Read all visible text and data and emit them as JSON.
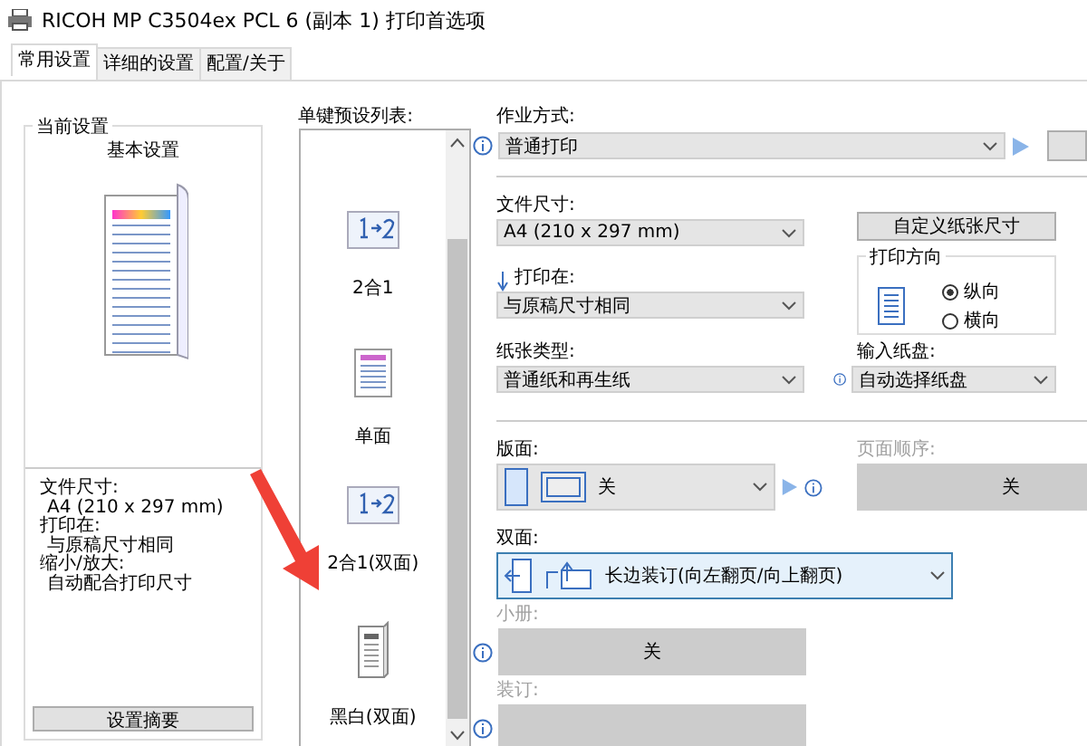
{
  "window": {
    "title": "RICOH MP C3504ex PCL 6 (副本 1) 打印首选项"
  },
  "tabs": [
    {
      "label": "常用设置",
      "selected": true
    },
    {
      "label": "详细的设置",
      "selected": false
    },
    {
      "label": "配置/关于",
      "selected": false
    }
  ],
  "current_settings": {
    "title": "当前设置",
    "preset_name": "基本设置",
    "summary": [
      {
        "label": "文件尺寸:",
        "value": "A4 (210 x 297 mm)"
      },
      {
        "label": "打印在:",
        "value": "与原稿尺寸相同"
      },
      {
        "label": "缩小/放大:",
        "value": "自动配合打印尺寸"
      }
    ],
    "button": "设置摘要"
  },
  "preset_list": {
    "label": "单键预设列表:",
    "items": [
      {
        "label": "2合1",
        "kind": "combine"
      },
      {
        "label": "单面",
        "kind": "page"
      },
      {
        "label": "2合1(双面)",
        "kind": "combine"
      },
      {
        "label": "黑白(双面)",
        "kind": "mono"
      }
    ]
  },
  "job_type": {
    "label": "作业方式:",
    "value": "普通打印"
  },
  "document_size": {
    "label": "文件尺寸:",
    "value": "A4 (210 x 297 mm)"
  },
  "custom_size_button": "自定义纸张尺寸",
  "orientation": {
    "title": "打印方向",
    "options": [
      {
        "label": "纵向",
        "selected": true
      },
      {
        "label": "横向",
        "selected": false
      }
    ]
  },
  "print_on": {
    "label": "打印在:",
    "value": "与原稿尺寸相同"
  },
  "paper_type": {
    "label": "纸张类型:",
    "value": "普通纸和再生纸"
  },
  "input_tray": {
    "label": "输入纸盘:",
    "value": "自动选择纸盘"
  },
  "layout": {
    "label": "版面:",
    "value": "关"
  },
  "page_order": {
    "label": "页面顺序:",
    "value": "关",
    "disabled": true
  },
  "duplex": {
    "label": "双面:",
    "value": "长边装订(向左翻页/向上翻页)"
  },
  "booklet": {
    "label": "小册:",
    "value": "关",
    "disabled": true
  },
  "binding": {
    "label": "装订:",
    "disabled": true
  }
}
